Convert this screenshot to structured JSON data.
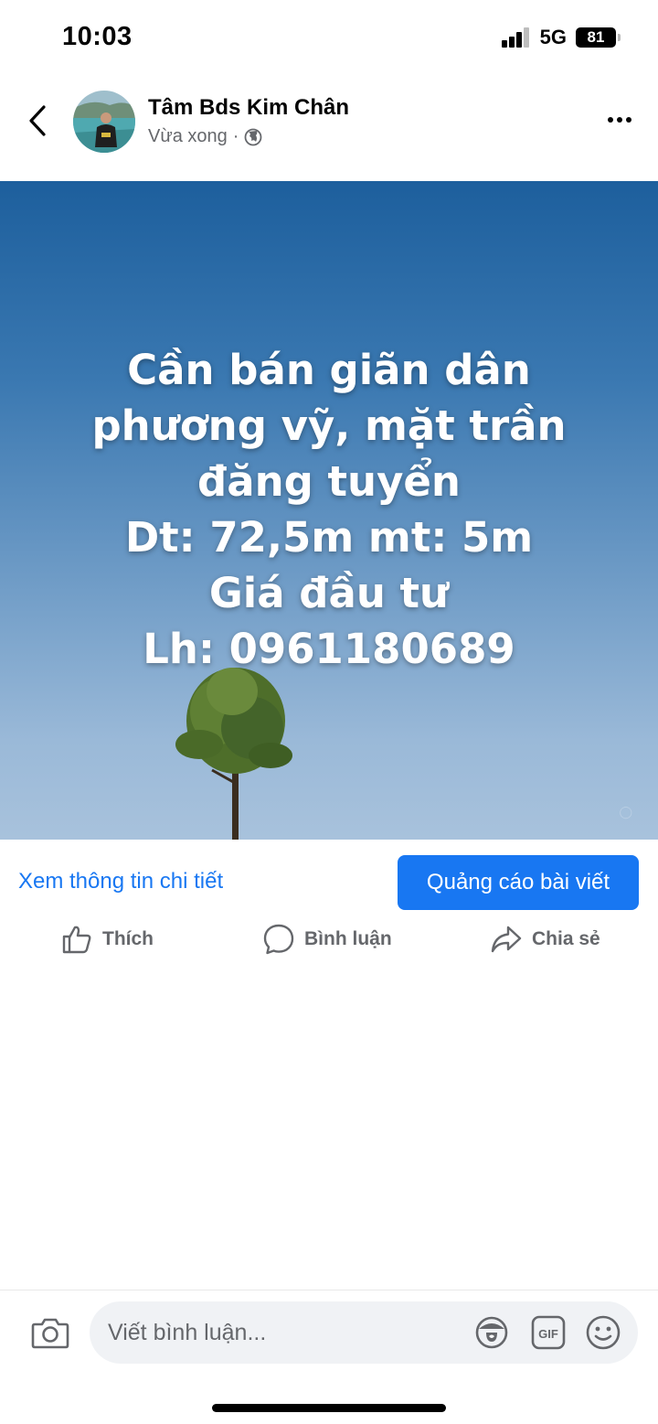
{
  "status_bar": {
    "time": "10:03",
    "network": "5G",
    "battery": "81"
  },
  "post": {
    "author_name": "Tâm Bds Kim Chân",
    "timestamp": "Vừa xong",
    "separator": "·",
    "privacy_icon": "globe-icon",
    "image_text_lines": [
      "Cần bán giãn dân",
      "phương vỹ, mặt trần",
      "đăng tuyển",
      "Dt: 72,5m mt: 5m",
      "Giá đầu tư",
      "Lh: 0961180689"
    ]
  },
  "actions": {
    "details_link": "Xem thông tin chi tiết",
    "boost_button": "Quảng cáo bài viết",
    "like_label": "Thích",
    "comment_label": "Bình luận",
    "share_label": "Chia sẻ"
  },
  "comment_bar": {
    "placeholder": "Viết bình luận...",
    "icons": [
      "camera-icon",
      "avatar-sticker-icon",
      "gif-icon",
      "emoji-icon"
    ]
  },
  "colors": {
    "accent": "#1877f2",
    "secondary_text": "#65676b",
    "input_bg": "#f0f2f5"
  }
}
